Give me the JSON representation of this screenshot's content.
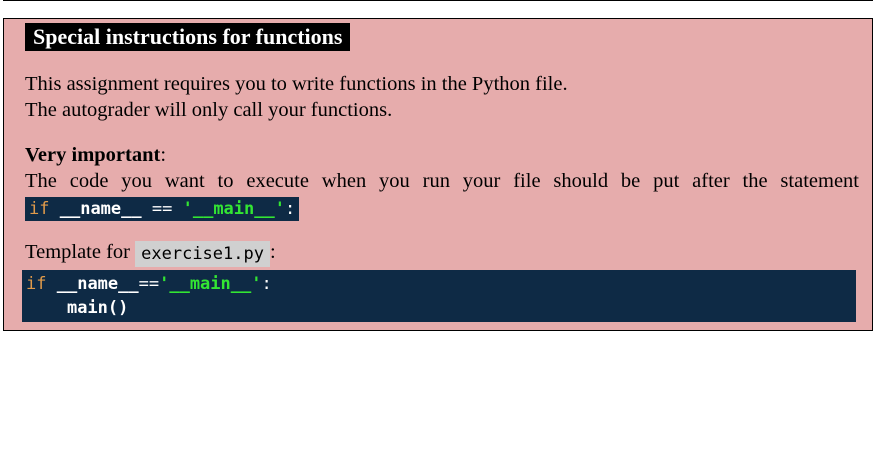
{
  "box": {
    "title": "Special instructions for functions",
    "para1_line1": "This assignment requires you to write functions in the Python file.",
    "para1_line2": "The autograder will only call your functions.",
    "important_label": "Very important",
    "important_colon": ":",
    "important_text": "The code you want to execute when you run your file should be put after the statement",
    "inline_code": {
      "keyword": "if",
      "name": "__name__",
      "operator": "==",
      "string": "'__main__'",
      "colon": ":"
    },
    "template_prefix": "Template for",
    "template_filename": "exercise1.py",
    "template_suffix": ":",
    "code_block": {
      "line1_keyword": "if",
      "line1_name": "__name__",
      "line1_operator": "==",
      "line1_string": "'__main__'",
      "line1_colon": ":",
      "line2_indent": "    ",
      "line2_call": "main()"
    }
  },
  "colors": {
    "box_background": "#e6acac",
    "code_background": "#0e2a45",
    "keyword": "#e09a4a",
    "string": "#33e633",
    "filename_background": "#d0d0d0"
  }
}
